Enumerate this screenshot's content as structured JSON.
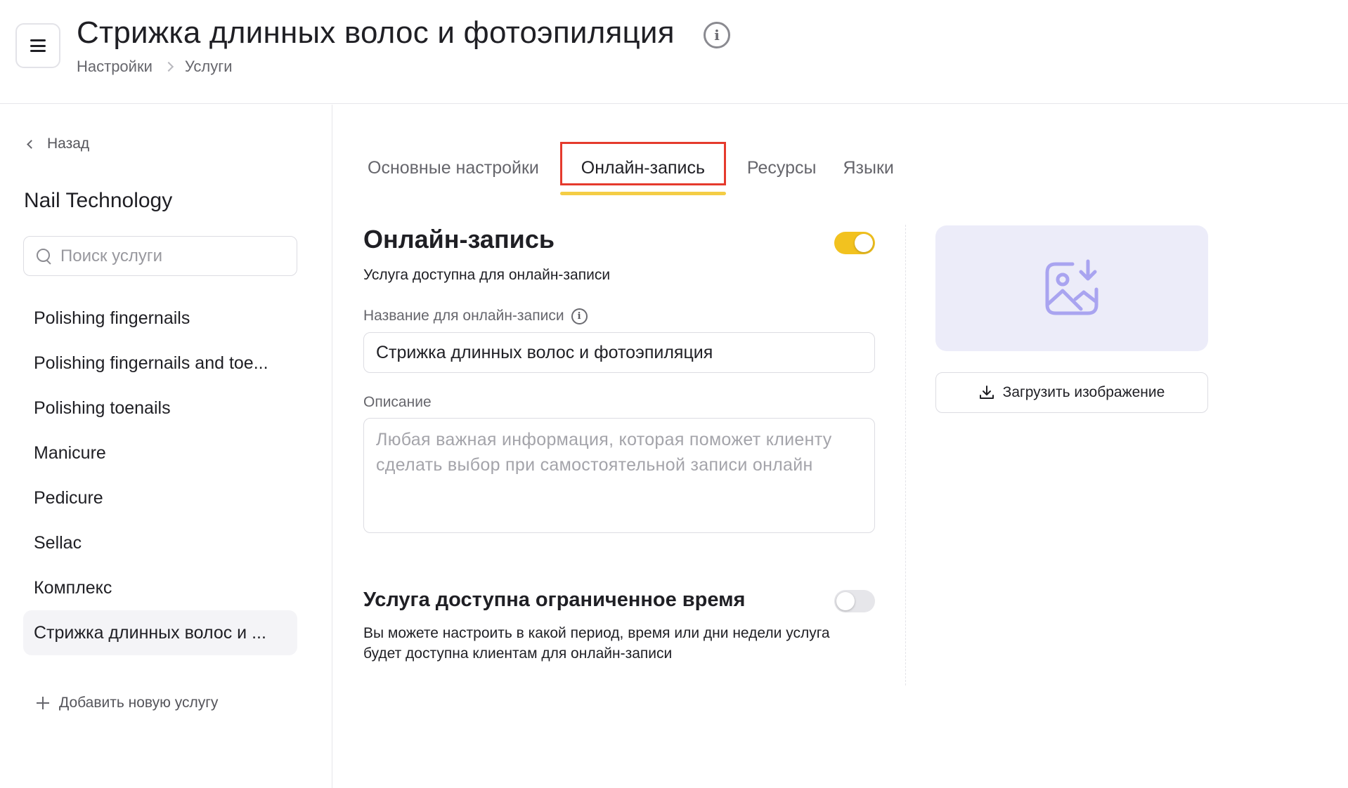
{
  "header": {
    "title": "Стрижка длинных волос и фотоэпиляция",
    "breadcrumb": [
      "Настройки",
      "Услуги"
    ]
  },
  "sidebar": {
    "back_label": "Назад",
    "category": "Nail Technology",
    "search_placeholder": "Поиск услуги",
    "search_value": "",
    "items": [
      {
        "label": "Polishing fingernails",
        "active": false
      },
      {
        "label": "Polishing fingernails and toe...",
        "active": false
      },
      {
        "label": "Polishing toenails",
        "active": false
      },
      {
        "label": "Manicure",
        "active": false
      },
      {
        "label": "Pedicure",
        "active": false
      },
      {
        "label": "Sellac",
        "active": false
      },
      {
        "label": "Комплекс",
        "active": false
      },
      {
        "label": "Стрижка длинных волос и ...",
        "active": true
      }
    ],
    "add_label": "Добавить новую услугу"
  },
  "tabs": [
    {
      "label": "Основные настройки",
      "active": false
    },
    {
      "label": "Онлайн-запись",
      "active": true
    },
    {
      "label": "Ресурсы",
      "active": false
    },
    {
      "label": "Языки",
      "active": false
    }
  ],
  "online_booking": {
    "title": "Онлайн-запись",
    "enabled": true,
    "subtitle": "Услуга доступна для онлайн-записи",
    "name_label": "Название для онлайн-записи",
    "name_value": "Стрижка длинных волос и фотоэпиляция",
    "description_label": "Описание",
    "description_placeholder": "Любая важная информация, которая поможет клиенту сделать выбор при самостоятельной записи онлайн",
    "description_value": ""
  },
  "limited_time": {
    "title": "Услуга доступна ограниченное время",
    "enabled": false,
    "description": "Вы можете настроить в какой период, время или дни недели услуга будет доступна клиентам для онлайн-записи"
  },
  "image": {
    "upload_label": "Загрузить изображение"
  },
  "colors": {
    "accent_yellow": "#f2c21f",
    "tab_underline": "#f4cd45",
    "highlight_red": "#e53a2d",
    "image_bg": "#ececf9",
    "image_icon": "#a9a4f0"
  },
  "icons": {
    "menu": "hamburger-icon",
    "title_info": "info-circle-icon",
    "breadcrumb_separator": "chevron-right-icon",
    "back": "chevron-left-icon",
    "search": "search-icon",
    "add": "plus-icon",
    "field_info": "info-circle-icon",
    "image_placeholder": "image-download-icon",
    "upload": "download-icon"
  }
}
